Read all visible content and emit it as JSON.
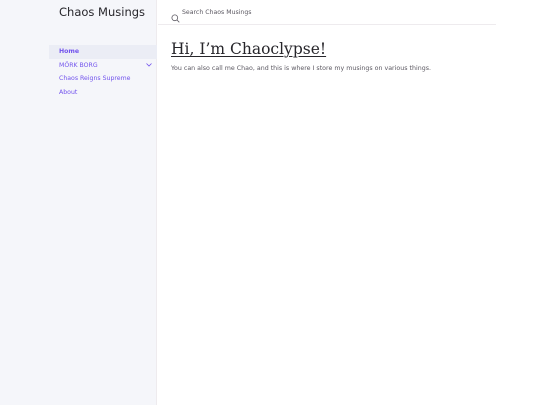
{
  "site": {
    "title": "Chaos Musings"
  },
  "search": {
    "placeholder": "Search Chaos Musings",
    "icon": "search-icon"
  },
  "nav": {
    "items": [
      {
        "label": "Home",
        "active": true
      },
      {
        "label": "MÖRK BORG",
        "expandable": true,
        "expander_icon": "chevron-down-icon"
      },
      {
        "label": "Chaos Reigns Supreme"
      },
      {
        "label": "About"
      }
    ]
  },
  "main": {
    "heading": "Hi, I’m Chaoclypse!",
    "intro": "You can also call me Chao, and this is where I store my musings on various things."
  },
  "colors": {
    "accent": "#7253ed",
    "sidebar_bg": "#f5f6fa",
    "active_item_bg": "#ebedf5",
    "text": "#27262b",
    "muted_text": "#5c5962"
  }
}
